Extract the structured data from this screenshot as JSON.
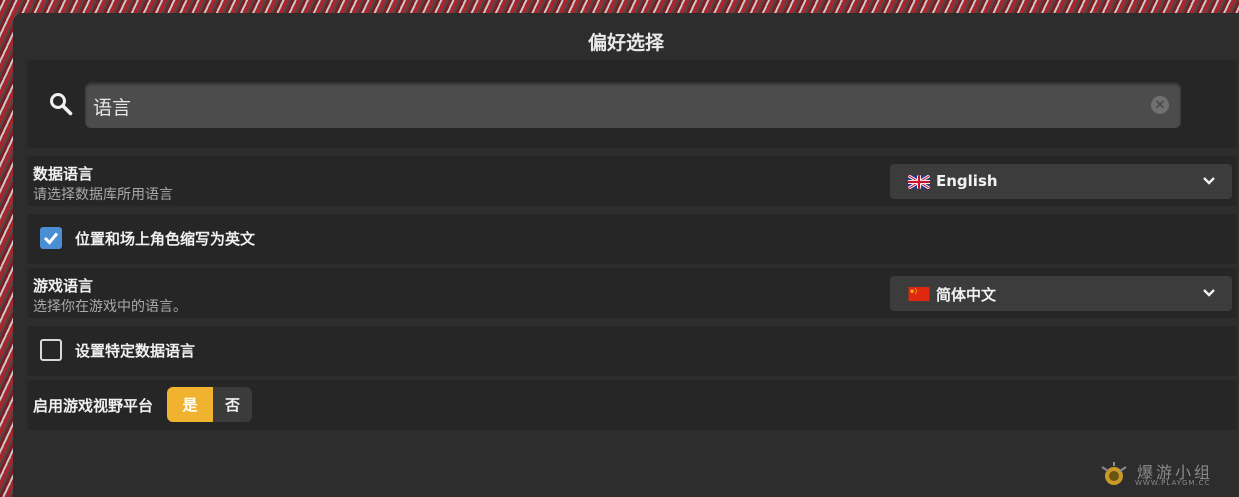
{
  "dialog": {
    "title": "偏好选择"
  },
  "search": {
    "value": "语言"
  },
  "settings": {
    "data_language": {
      "title": "数据语言",
      "subtitle": "请选择数据库所用语言",
      "selected": "English",
      "flag_icon": "uk-flag-icon"
    },
    "abbreviate_positions": {
      "label": "位置和场上角色缩写为英文",
      "checked": true
    },
    "game_language": {
      "title": "游戏语言",
      "subtitle": "选择你在游戏中的语言。",
      "selected": "简体中文",
      "flag_icon": "china-flag-icon"
    },
    "specific_data_language": {
      "label": "设置特定数据语言",
      "checked": false
    },
    "game_vision": {
      "label": "启用游戏视野平台",
      "yes_label": "是",
      "no_label": "否",
      "selected": "yes"
    }
  },
  "colors": {
    "accent": "#f0b32f",
    "checkbox": "#4a8fd3",
    "panel": "#262626",
    "window": "#2d2d2d"
  },
  "watermark": {
    "text": "爆游小组",
    "url": "WWW.PLAYGM.CC"
  }
}
